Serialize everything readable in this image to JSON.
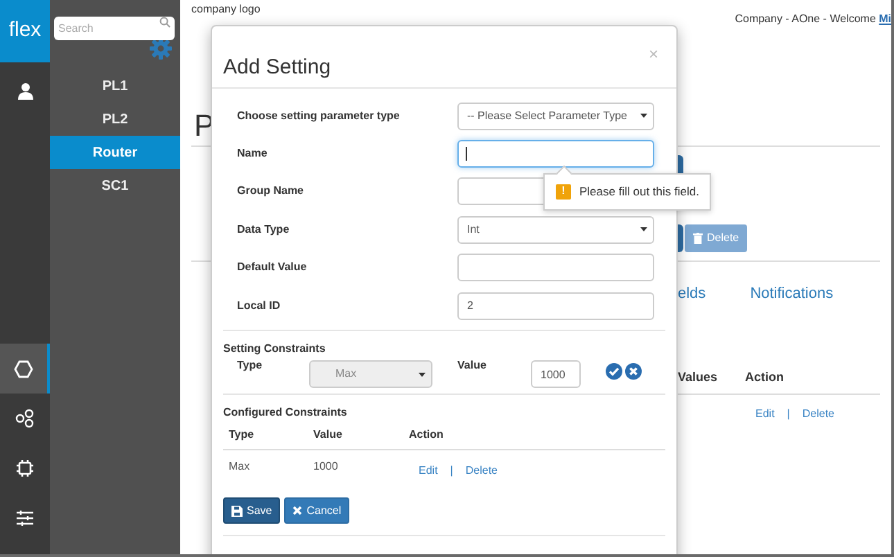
{
  "rail": {
    "logo": "flex",
    "items": [
      {
        "kind": "user",
        "selected": false
      },
      {
        "kind": "hexagon",
        "selected": true
      },
      {
        "kind": "nodes",
        "selected": false
      },
      {
        "kind": "chip",
        "selected": false
      },
      {
        "kind": "sliders",
        "selected": false
      }
    ]
  },
  "sidebar": {
    "search": {
      "placeholder": "Search"
    },
    "items": [
      {
        "label": "PL1",
        "selected": false
      },
      {
        "label": "PL2",
        "selected": false
      },
      {
        "label": "Router",
        "selected": true
      },
      {
        "label": "SC1",
        "selected": false
      }
    ]
  },
  "header": {
    "logo_text": "company logo",
    "welcome": "Company - AOne - Welcome ",
    "user": "Mi"
  },
  "page": {
    "heading": "P",
    "delete_button": "Delete",
    "tabs": [
      "elds",
      "Notifications"
    ],
    "columns": [
      "Values",
      "Action"
    ],
    "row_actions": [
      "Edit",
      "|",
      "Delete"
    ]
  },
  "modal": {
    "title": "Add Setting",
    "close": "×",
    "fields": [
      {
        "label": "Choose setting parameter type",
        "kind": "select",
        "value": "-- Please Select Parameter Type",
        "focused": false
      },
      {
        "label": "Name",
        "kind": "input",
        "focused": true
      },
      {
        "label": "Group Name",
        "kind": "input",
        "focused": false
      },
      {
        "label": "Data Type",
        "kind": "select",
        "value": "Int",
        "focused": false
      },
      {
        "label": "Default Value",
        "kind": "input",
        "focused": false
      },
      {
        "label": "Local ID",
        "kind": "input",
        "value": "2",
        "focused": false
      }
    ],
    "validation": {
      "icon": "!",
      "message": "Please fill out this field."
    },
    "constraints": {
      "title": "Setting Constraints",
      "type_label": "Type",
      "type_value": "Max",
      "disabled": true,
      "value_label": "Value",
      "value": "1000"
    },
    "configured": {
      "title": "Configured Constraints",
      "columns": [
        "Type",
        "Value",
        "Action"
      ],
      "rows": [
        {
          "cells": [
            "Max",
            "1000"
          ],
          "actions": [
            "Edit",
            "|",
            "Delete"
          ]
        }
      ]
    },
    "buttons": [
      {
        "label": "Save",
        "kind": "primary"
      },
      {
        "label": "Cancel",
        "kind": "secondary"
      }
    ]
  }
}
